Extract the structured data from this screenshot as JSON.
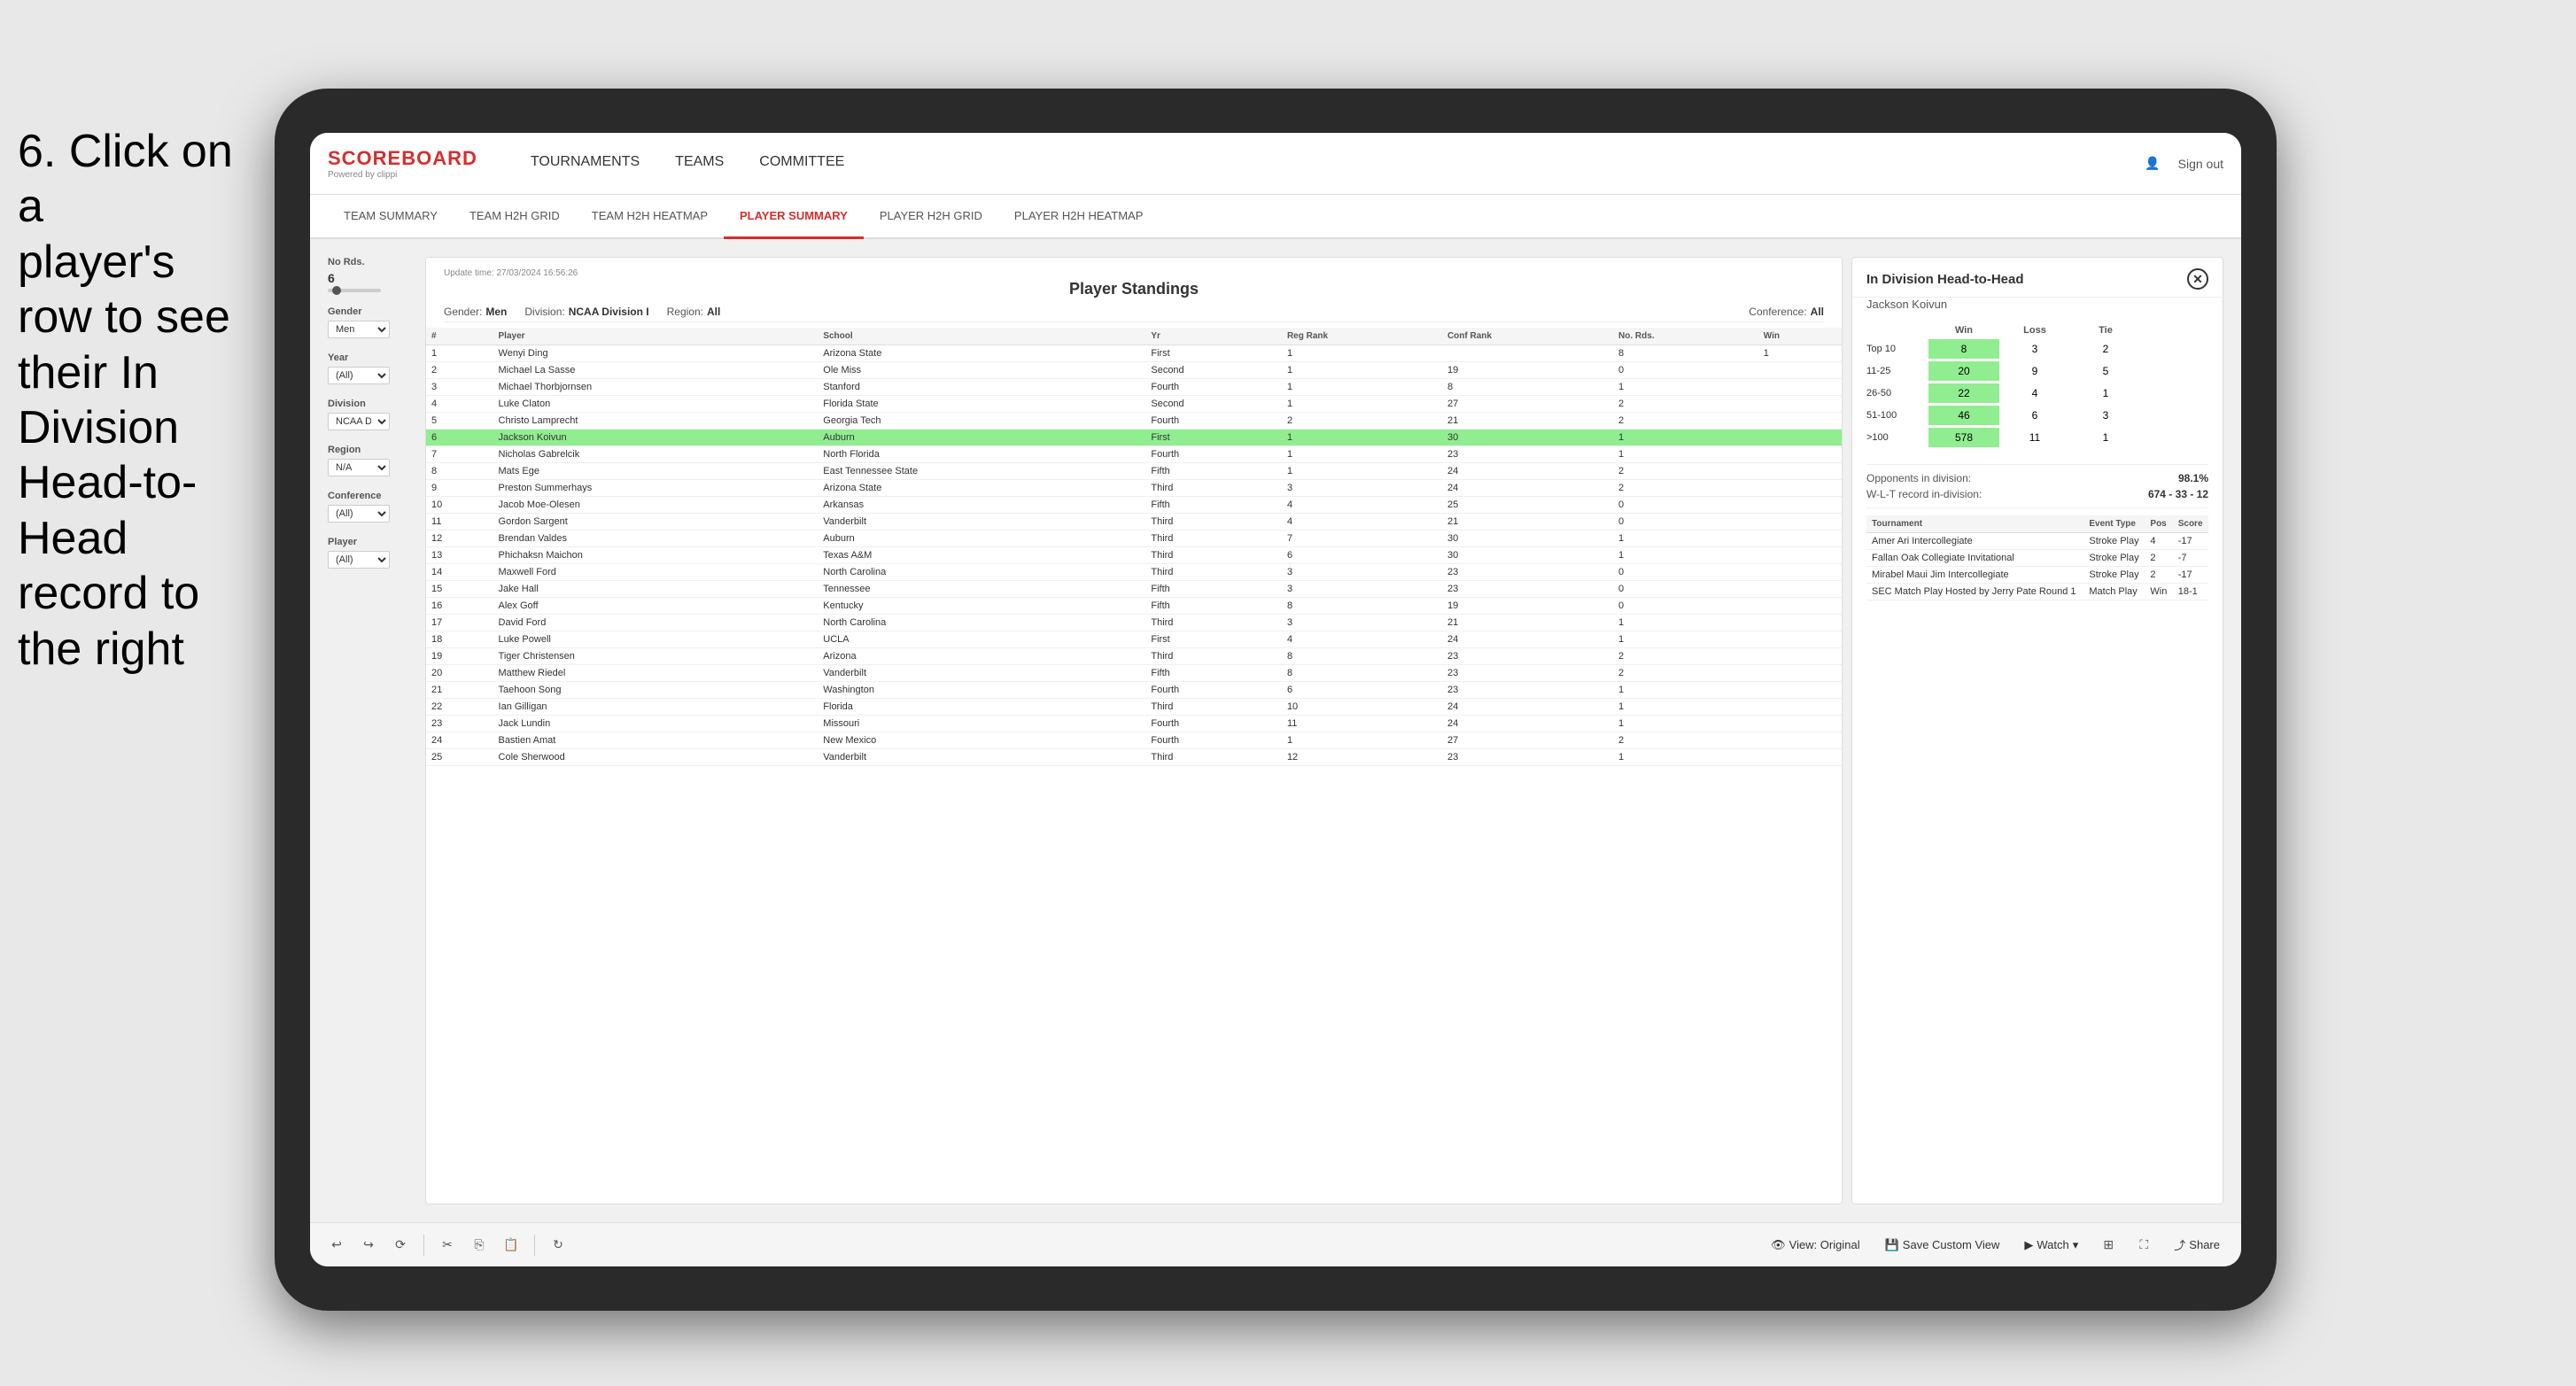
{
  "instruction": {
    "line1": "6. Click on a",
    "line2": "player's row to see",
    "line3": "their In Division",
    "line4": "Head-to-Head",
    "line5": "record to the right"
  },
  "nav": {
    "logo": "SCOREBOARD",
    "logo_sub": "Powered by clippi",
    "items": [
      "TOURNAMENTS",
      "TEAMS",
      "COMMITTEE"
    ],
    "sign_out": "Sign out"
  },
  "secondary_nav": {
    "items": [
      "TEAM SUMMARY",
      "TEAM H2H GRID",
      "TEAM H2H HEATMAP",
      "PLAYER SUMMARY",
      "PLAYER H2H GRID",
      "PLAYER H2H HEATMAP"
    ],
    "active": "PLAYER SUMMARY"
  },
  "sidebar": {
    "no_rds_label": "No Rds.",
    "no_rds_value": "6",
    "gender_label": "Gender",
    "gender_value": "Men",
    "year_label": "Year",
    "year_value": "(All)",
    "division_label": "Division",
    "division_value": "NCAA Division I",
    "region_label": "Region",
    "region_value": "N/A",
    "conference_label": "Conference",
    "conference_value": "(All)",
    "player_label": "Player",
    "player_value": "(All)"
  },
  "standings": {
    "title": "Player Standings",
    "update_time": "Update time: 27/03/2024 16:56:26",
    "gender": "Men",
    "division": "NCAA Division I",
    "region": "All",
    "conference": "All",
    "columns": [
      "#",
      "Player",
      "School",
      "Yr",
      "Reg Rank",
      "Conf Rank",
      "No. Rds.",
      "Win"
    ],
    "rows": [
      {
        "num": 1,
        "player": "Wenyi Ding",
        "school": "Arizona State",
        "yr": "First",
        "reg": 1,
        "conf": "",
        "rds": 8,
        "win": 1
      },
      {
        "num": 2,
        "player": "Michael La Sasse",
        "school": "Ole Miss",
        "yr": "Second",
        "reg": 1,
        "conf": 19,
        "rds": 0
      },
      {
        "num": 3,
        "player": "Michael Thorbjornsen",
        "school": "Stanford",
        "yr": "Fourth",
        "reg": 1,
        "conf": 8,
        "rds": 1
      },
      {
        "num": 4,
        "player": "Luke Claton",
        "school": "Florida State",
        "yr": "Second",
        "reg": 1,
        "conf": 27,
        "rds": 2
      },
      {
        "num": 5,
        "player": "Christo Lamprecht",
        "school": "Georgia Tech",
        "yr": "Fourth",
        "reg": 2,
        "conf": 21,
        "rds": 2
      },
      {
        "num": 6,
        "player": "Jackson Koivun",
        "school": "Auburn",
        "yr": "First",
        "reg": 1,
        "conf": 30,
        "rds": 1,
        "selected": true
      },
      {
        "num": 7,
        "player": "Nicholas Gabrelcik",
        "school": "North Florida",
        "yr": "Fourth",
        "reg": 1,
        "conf": 23,
        "rds": 1
      },
      {
        "num": 8,
        "player": "Mats Ege",
        "school": "East Tennessee State",
        "yr": "Fifth",
        "reg": 1,
        "conf": 24,
        "rds": 2
      },
      {
        "num": 9,
        "player": "Preston Summerhays",
        "school": "Arizona State",
        "yr": "Third",
        "reg": 3,
        "conf": 24,
        "rds": 2
      },
      {
        "num": 10,
        "player": "Jacob Moe-Olesen",
        "school": "Arkansas",
        "yr": "Fifth",
        "reg": 4,
        "conf": 25,
        "rds": 0
      },
      {
        "num": 11,
        "player": "Gordon Sargent",
        "school": "Vanderbilt",
        "yr": "Third",
        "reg": 4,
        "conf": 21,
        "rds": 0
      },
      {
        "num": 12,
        "player": "Brendan Valdes",
        "school": "Auburn",
        "yr": "Third",
        "reg": 7,
        "conf": 30,
        "rds": 1
      },
      {
        "num": 13,
        "player": "Phichaksn Maichon",
        "school": "Texas A&M",
        "yr": "Third",
        "reg": 6,
        "conf": 30,
        "rds": 1
      },
      {
        "num": 14,
        "player": "Maxwell Ford",
        "school": "North Carolina",
        "yr": "Third",
        "reg": 3,
        "conf": 23,
        "rds": 0
      },
      {
        "num": 15,
        "player": "Jake Hall",
        "school": "Tennessee",
        "yr": "Fifth",
        "reg": 3,
        "conf": 23,
        "rds": 0
      },
      {
        "num": 16,
        "player": "Alex Goff",
        "school": "Kentucky",
        "yr": "Fifth",
        "reg": 8,
        "conf": 19,
        "rds": 0
      },
      {
        "num": 17,
        "player": "David Ford",
        "school": "North Carolina",
        "yr": "Third",
        "reg": 3,
        "conf": 21,
        "rds": 1
      },
      {
        "num": 18,
        "player": "Luke Powell",
        "school": "UCLA",
        "yr": "First",
        "reg": 4,
        "conf": 24,
        "rds": 1
      },
      {
        "num": 19,
        "player": "Tiger Christensen",
        "school": "Arizona",
        "yr": "Third",
        "reg": 8,
        "conf": 23,
        "rds": 2
      },
      {
        "num": 20,
        "player": "Matthew Riedel",
        "school": "Vanderbilt",
        "yr": "Fifth",
        "reg": 8,
        "conf": 23,
        "rds": 2
      },
      {
        "num": 21,
        "player": "Taehoon Song",
        "school": "Washington",
        "yr": "Fourth",
        "reg": 6,
        "conf": 23,
        "rds": 1
      },
      {
        "num": 22,
        "player": "Ian Gilligan",
        "school": "Florida",
        "yr": "Third",
        "reg": 10,
        "conf": 24,
        "rds": 1
      },
      {
        "num": 23,
        "player": "Jack Lundin",
        "school": "Missouri",
        "yr": "Fourth",
        "reg": 11,
        "conf": 24,
        "rds": 1
      },
      {
        "num": 24,
        "player": "Bastien Amat",
        "school": "New Mexico",
        "yr": "Fourth",
        "reg": 1,
        "conf": 27,
        "rds": 2
      },
      {
        "num": 25,
        "player": "Cole Sherwood",
        "school": "Vanderbilt",
        "yr": "Third",
        "reg": 12,
        "conf": 23,
        "rds": 1
      }
    ]
  },
  "h2h": {
    "title": "In Division Head-to-Head",
    "player": "Jackson Koivun",
    "col_win": "Win",
    "col_loss": "Loss",
    "col_tie": "Tie",
    "rows": [
      {
        "label": "Top 10",
        "win": 8,
        "loss": 3,
        "tie": 2,
        "win_green": true
      },
      {
        "label": "11-25",
        "win": 20,
        "loss": 9,
        "tie": 5,
        "win_green": true
      },
      {
        "label": "26-50",
        "win": 22,
        "loss": 4,
        "tie": 1,
        "win_green": true
      },
      {
        "label": "51-100",
        "win": 46,
        "loss": 6,
        "tie": 3,
        "win_green": true
      },
      {
        "label": ">100",
        "win": 578,
        "loss": 11,
        "tie": 1,
        "win_green": true
      }
    ],
    "opponents_label": "Opponents in division:",
    "opponents_value": "98.1%",
    "wl_label": "W-L-T record in-division:",
    "wl_value": "674 - 33 - 12",
    "tournament_columns": [
      "Tournament",
      "Event Type",
      "Pos",
      "Score"
    ],
    "tournaments": [
      {
        "tournament": "Amer Ari Intercollegiate",
        "type": "Stroke Play",
        "pos": 4,
        "score": "-17"
      },
      {
        "tournament": "Fallan Oak Collegiate Invitational",
        "type": "Stroke Play",
        "pos": 2,
        "score": "-7"
      },
      {
        "tournament": "Mirabel Maui Jim Intercollegiate",
        "type": "Stroke Play",
        "pos": 2,
        "score": "-17"
      },
      {
        "tournament": "SEC Match Play Hosted by Jerry Pate Round 1",
        "type": "Match Play",
        "pos": "Win",
        "score": "18-1"
      }
    ]
  },
  "toolbar": {
    "view_original": "View: Original",
    "save_custom": "Save Custom View",
    "watch": "Watch",
    "share": "Share"
  }
}
